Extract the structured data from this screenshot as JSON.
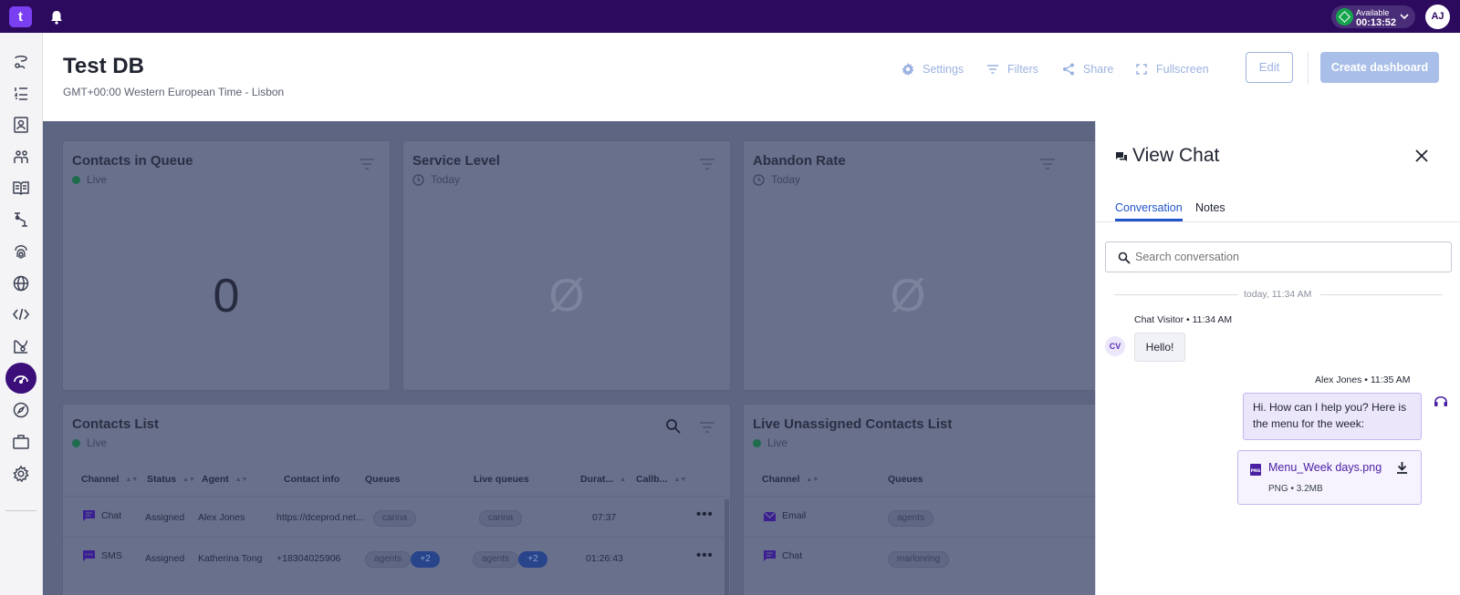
{
  "topbar": {
    "logo_text": "t",
    "status_label": "Available",
    "status_timer": "00:13:52",
    "user_initials": "AJ",
    "status_color": "#14a44d",
    "bar_color": "#2c0a5e"
  },
  "sidebar": {
    "icons": [
      "feedback-icon",
      "list-icon",
      "contacts-book-icon",
      "people-icon",
      "knowledge-book-icon",
      "routing-icon",
      "fingerprint-icon",
      "globe-icon",
      "code-icon",
      "route-map-icon",
      "dashboard-gauge-icon",
      "compass-icon",
      "briefcase-icon",
      "gear-icon"
    ],
    "active": "dashboard-gauge-icon"
  },
  "header": {
    "title": "Test DB",
    "timezone": "GMT+00:00 Western European Time - Lisbon",
    "settings_label": "Settings",
    "filters_label": "Filters",
    "share_label": "Share",
    "fullscreen_label": "Fullscreen",
    "edit_label": "Edit",
    "create_label": "Create dashboard"
  },
  "cards": {
    "queue": {
      "title": "Contacts in Queue",
      "sub": "Live",
      "value": "0"
    },
    "service": {
      "title": "Service Level",
      "sub": "Today",
      "value": "Ø"
    },
    "abandon": {
      "title": "Abandon Rate",
      "sub": "Today",
      "value": "Ø"
    }
  },
  "contacts_list": {
    "title": "Contacts List",
    "sub": "Live",
    "columns": [
      "Channel",
      "Status",
      "Agent",
      "Contact info",
      "Queues",
      "Live queues",
      "Durat...",
      "Callb..."
    ],
    "rows": [
      {
        "channel": "Chat",
        "status": "Assigned",
        "agent": "Alex Jones",
        "contact": "https://dceprod.net...",
        "queue": "carina",
        "live_queue": "carina",
        "queue_more": "",
        "live_more": "",
        "duration": "07:37"
      },
      {
        "channel": "SMS",
        "status": "Assigned",
        "agent": "Katherina Tong",
        "contact": "+18304025906",
        "queue": "agents",
        "live_queue": "agents",
        "queue_more": "+2",
        "live_more": "+2",
        "duration": "01:26:43"
      }
    ]
  },
  "unassigned_list": {
    "title": "Live Unassigned Contacts List",
    "sub": "Live",
    "columns": [
      "Channel",
      "Queues"
    ],
    "rows": [
      {
        "channel": "Email",
        "queue": "agents"
      },
      {
        "channel": "Chat",
        "queue": "marlonring"
      }
    ]
  },
  "panel": {
    "title": "View Chat",
    "tabs": [
      "Conversation",
      "Notes"
    ],
    "active_tab": "Conversation",
    "search_placeholder": "Search conversation",
    "date_divider": "today, 11:34 AM",
    "messages": [
      {
        "initials": "CV",
        "meta": "Chat Visitor • 11:34 AM",
        "text": "Hello!"
      },
      {
        "meta": "Alex Jones • 11:35 AM",
        "text": "Hi. How can I help you? Here is the menu for the week:"
      }
    ],
    "attachment": {
      "name": "Menu_Week days.png",
      "meta": "PNG • 3.2MB",
      "badge": "PNG"
    }
  }
}
